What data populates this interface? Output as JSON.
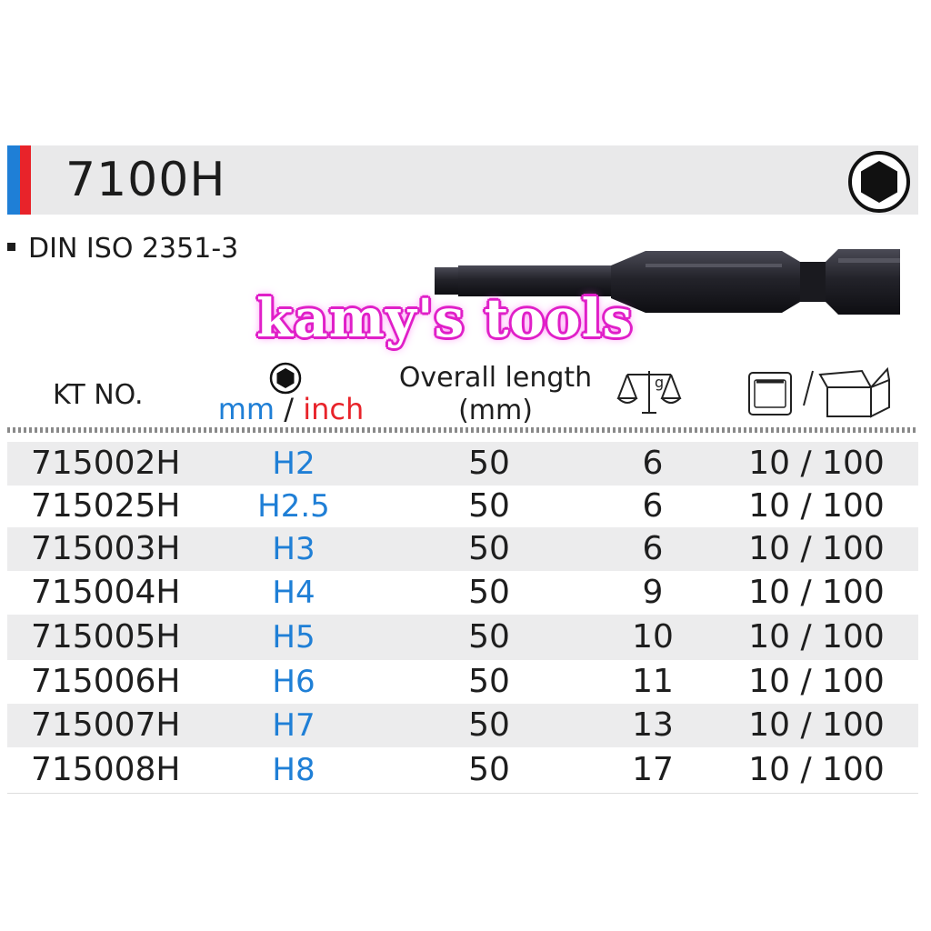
{
  "header": {
    "model": "7100H",
    "standard": "DIN ISO 2351-3"
  },
  "watermark": "kamy's tools",
  "columns": {
    "kt_no": "KT NO.",
    "size_mm": "mm",
    "size_sep": " / ",
    "size_inch": "inch",
    "length_line1": "Overall length",
    "length_line2": "(mm)",
    "weight_unit": "g"
  },
  "colors": {
    "accent_blue": "#1f7fd6",
    "accent_red": "#e8232a",
    "watermark_pink": "#e020c8"
  },
  "icons": {
    "header_badge": "hex-socket-icon",
    "size_column": "hex-socket-icon",
    "weight_column": "scale-icon",
    "pack_column": [
      "single-pack-icon",
      "box-icon"
    ]
  },
  "rows": [
    {
      "kt_no": "715002H",
      "size": "H2",
      "length": "50",
      "weight": "6",
      "pack": "10 / 100"
    },
    {
      "kt_no": "715025H",
      "size": "H2.5",
      "length": "50",
      "weight": "6",
      "pack": "10 / 100"
    },
    {
      "kt_no": "715003H",
      "size": "H3",
      "length": "50",
      "weight": "6",
      "pack": "10 / 100"
    },
    {
      "kt_no": "715004H",
      "size": "H4",
      "length": "50",
      "weight": "9",
      "pack": "10 / 100"
    },
    {
      "kt_no": "715005H",
      "size": "H5",
      "length": "50",
      "weight": "10",
      "pack": "10 / 100"
    },
    {
      "kt_no": "715006H",
      "size": "H6",
      "length": "50",
      "weight": "11",
      "pack": "10 / 100"
    },
    {
      "kt_no": "715007H",
      "size": "H7",
      "length": "50",
      "weight": "13",
      "pack": "10 / 100"
    },
    {
      "kt_no": "715008H",
      "size": "H8",
      "length": "50",
      "weight": "17",
      "pack": "10 / 100"
    }
  ]
}
